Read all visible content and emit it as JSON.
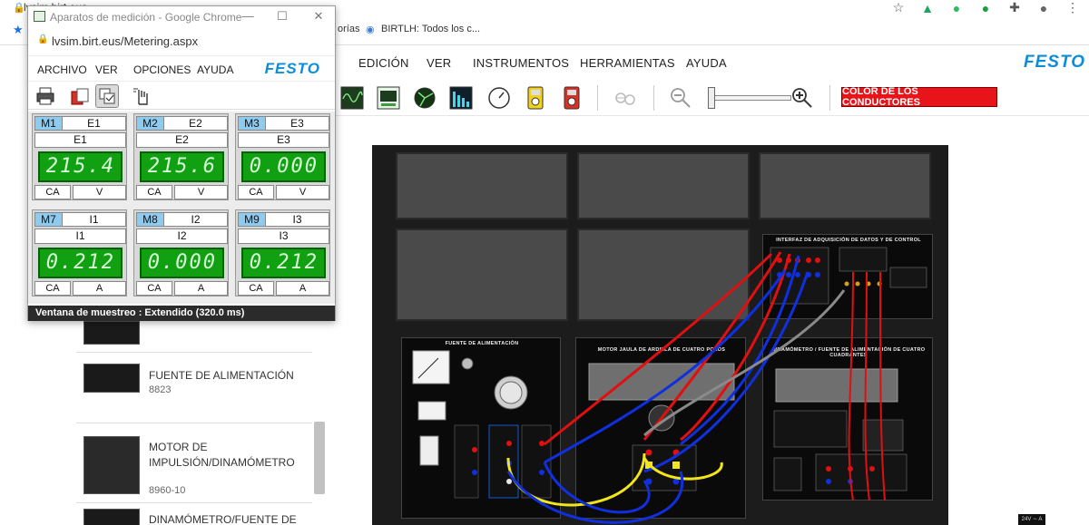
{
  "browser": {
    "url_fragment": "lvsim.birt.eus",
    "bookmarks": [
      {
        "label": "orías"
      },
      {
        "label": "BIRTLH: Todos los c..."
      }
    ]
  },
  "app_menu": {
    "items": [
      "EDICIÓN",
      "VER",
      "INSTRUMENTOS",
      "HERRAMIENTAS",
      "AYUDA"
    ],
    "brand": "FESTO"
  },
  "app_toolbar": {
    "conductor_color_button": "COLOR DE LOS CONDUCTORES",
    "accent_red": "#e8141a"
  },
  "sidebar": {
    "items": [
      {
        "title": "FUENTE DE ALIMENTACIÓN",
        "code": "8823"
      },
      {
        "title": "MOTOR DE IMPULSIÓN/DINAMÓMETRO",
        "code": "8960-10"
      },
      {
        "title": "DINAMÓMETRO/FUENTE DE",
        "code": ""
      }
    ]
  },
  "bench": {
    "interface_title": "INTERFAZ DE ADQUISICIÓN DE DATOS Y DE CONTROL",
    "power_title": "FUENTE DE ALIMENTACIÓN",
    "motor_title": "MOTOR JAULA DE ARDILLA DE CUATRO POLOS",
    "dyn_title": "DINAMÓMETRO / FUENTE DE ALIMENTACIÓN DE CUATRO CUADRANTES",
    "corner_badge": "24V ∼ A"
  },
  "popup": {
    "window_title": "Aparatos de medición - Google Chrome",
    "url": "lvsim.birt.eus/Metering.aspx",
    "menu": [
      "ARCHIVO",
      "VER",
      "OPCIONES",
      "AYUDA"
    ],
    "brand": "FESTO",
    "status": "Ventana de muestreo : Extendido (320.0 ms)",
    "meters": [
      {
        "id": "M1",
        "name": "E1",
        "label": "E1",
        "value": "215.4",
        "type": "CA",
        "unit": "V"
      },
      {
        "id": "M2",
        "name": "E2",
        "label": "E2",
        "value": "215.6",
        "type": "CA",
        "unit": "V"
      },
      {
        "id": "M3",
        "name": "E3",
        "label": "E3",
        "value": "0.000",
        "type": "CA",
        "unit": "V"
      },
      {
        "id": "M7",
        "name": "I1",
        "label": "I1",
        "value": "0.212",
        "type": "CA",
        "unit": "A"
      },
      {
        "id": "M8",
        "name": "I2",
        "label": "I2",
        "value": "0.000",
        "type": "CA",
        "unit": "A"
      },
      {
        "id": "M9",
        "name": "I3",
        "label": "I3",
        "value": "0.212",
        "type": "CA",
        "unit": "A"
      }
    ]
  }
}
